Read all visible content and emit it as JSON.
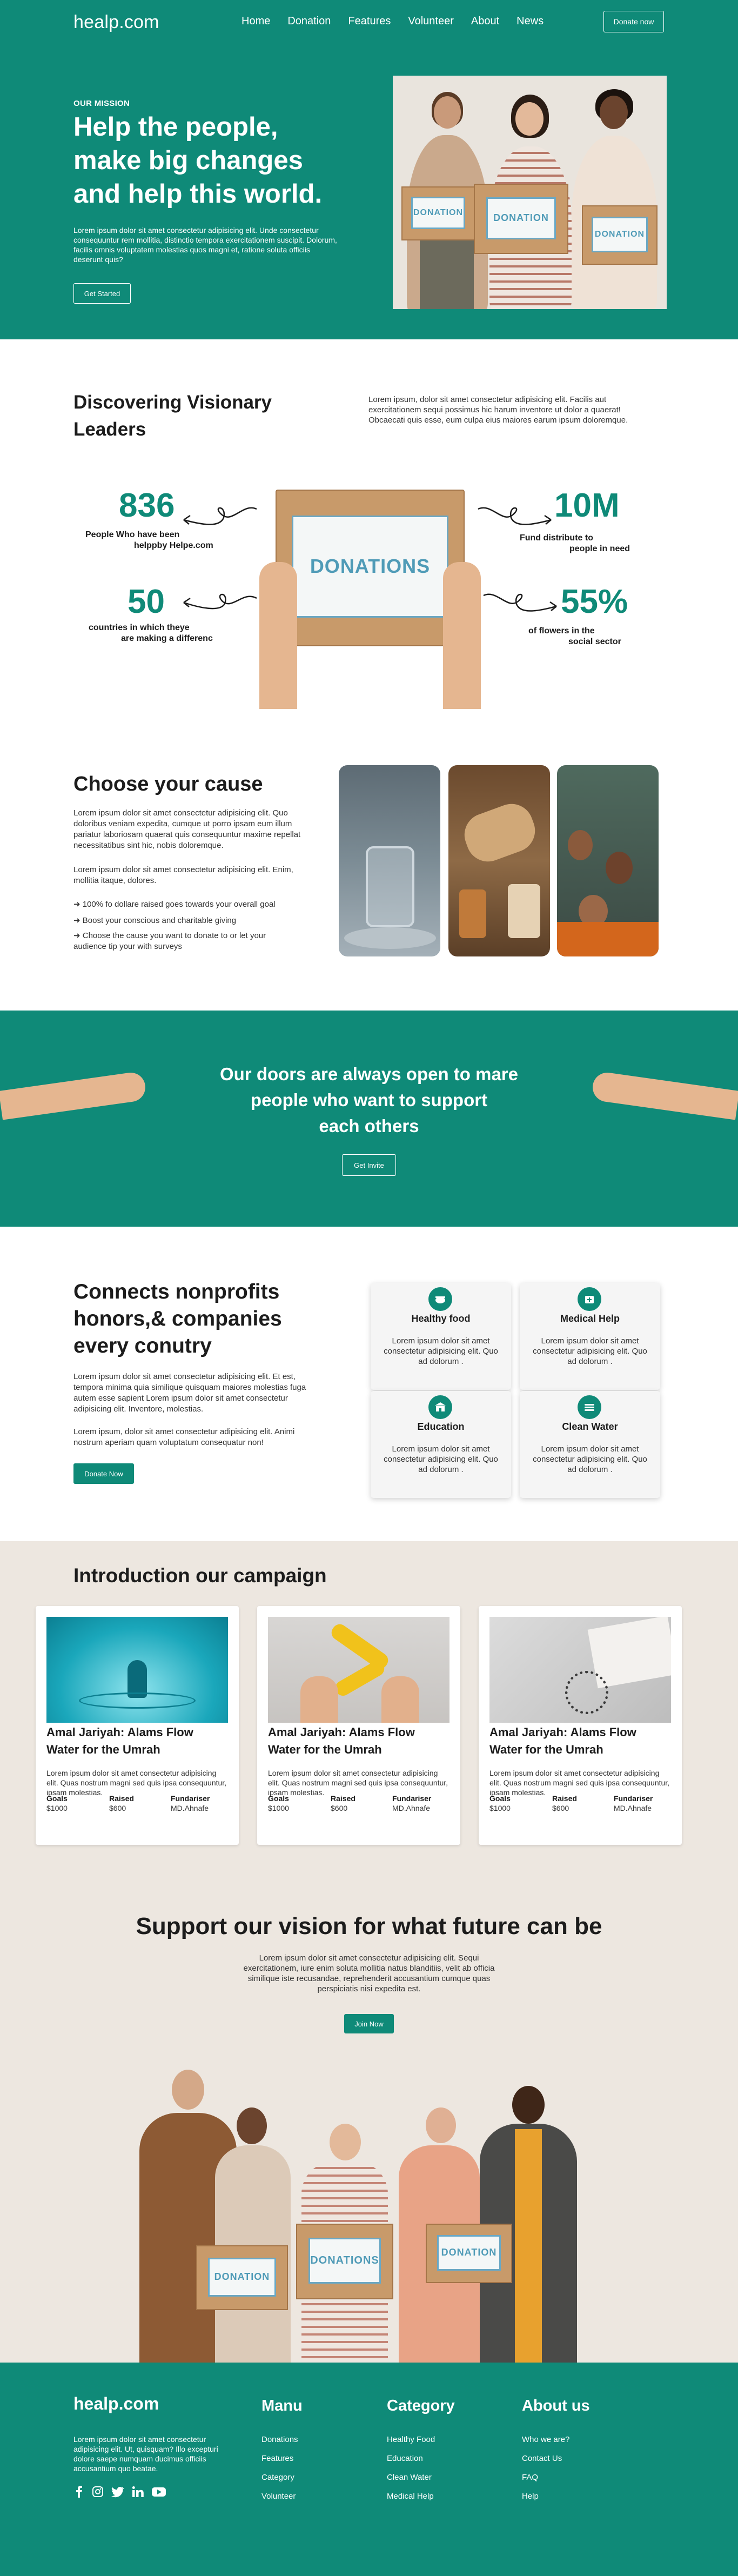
{
  "nav": {
    "logo": "healp.com",
    "menu": [
      "Home",
      "Donation",
      "Features",
      "Volunteer",
      "About",
      "News"
    ],
    "cta": "Donate now"
  },
  "hero": {
    "kicker": "OUR MISSION",
    "title_lines": [
      "Help the people,",
      "make big changes",
      "and help this world."
    ],
    "text": "Lorem ipsum dolor sit amet consectetur adipisicing elit. Unde consectetur consequuntur rem mollitia, distinctio tempora exercitationem suscipit. Dolorum, facilis omnis voluptatem molestias quos magni et, ratione soluta officiis deserunt quis?",
    "button": "Get Started",
    "box_label": "DONATION"
  },
  "leaders": {
    "title_lines": [
      "Discovering Visionary",
      "Leaders"
    ],
    "text": "Lorem ipsum, dolor sit amet consectetur adipisicing elit. Facilis aut exercitationem sequi possimus hic harum inventore ut dolor a quaerat! Obcaecati quis esse, eum culpa eius maiores earum ipsum doloremque.",
    "box_label": "DONATIONS",
    "stats": [
      {
        "value": "836",
        "label_lines": [
          "People Who have been",
          "helppby Helpe.com"
        ]
      },
      {
        "value": "10M",
        "label_lines": [
          "Fund distribute to",
          "people in need"
        ]
      },
      {
        "value": "50",
        "label_lines": [
          "countries in which theye",
          "are making a differenc"
        ]
      },
      {
        "value": "55%",
        "label_lines": [
          "of flowers in the",
          "social sector"
        ]
      }
    ]
  },
  "cause": {
    "title": "Choose your cause",
    "p1": "Lorem ipsum dolor sit amet consectetur adipisicing elit. Quo doloribus veniam expedita, cumque ut porro ipsam eum illum pariatur laboriosam quaerat quis consequuntur maxime repellat necessitatibus sint hic, nobis doloremque.",
    "p2": "Lorem ipsum dolor sit amet consectetur adipisicing elit. Enim, mollitia itaque, dolores.",
    "checks": [
      "100% fo dollare raised goes towards your overall goal",
      "Boost your conscious and charitable giving",
      "Choose the cause you want to donate to or let your audience tip your with surveys"
    ],
    "arrow": "➜"
  },
  "banner": {
    "title_lines": [
      "Our doors are always open to mare",
      "people who want to support",
      "each others"
    ],
    "button": "Get Invite"
  },
  "connects": {
    "title_lines": [
      "Connects nonprofits",
      "honors,& companies",
      "every conutry"
    ],
    "p1": "Lorem ipsum dolor sit amet consectetur adipisicing elit. Et est, tempora minima quia similique quisquam maiores molestias fuga autem esse sapient Lorem ipsum dolor sit amet consectetur adipisicing elit. Inventore, molestias.",
    "p2": "Lorem ipsum, dolor sit amet consectetur adipisicing elit. Animi nostrum aperiam quam voluptatum consequatur non!",
    "button": "Donate Now",
    "cards": [
      {
        "title": "Healthy food",
        "icon": "food-icon",
        "text": "Lorem ipsum dolor sit amet consectetur adipisicing elit. Quo ad dolorum ."
      },
      {
        "title": "Medical Help",
        "icon": "medical-icon",
        "text": "Lorem ipsum dolor sit amet consectetur adipisicing elit. Quo ad dolorum ."
      },
      {
        "title": "Education",
        "icon": "school-icon",
        "text": "Lorem ipsum dolor sit amet consectetur adipisicing elit. Quo ad dolorum ."
      },
      {
        "title": "Clean Water",
        "icon": "water-icon",
        "text": "Lorem ipsum dolor sit amet consectetur adipisicing elit. Quo ad dolorum ."
      }
    ]
  },
  "campaign": {
    "title": "Introduction our campaign",
    "cards": [
      {
        "title_lines": [
          "Amal Jariyah: Alams Flow",
          "Water for the Umrah"
        ],
        "text": "Lorem ipsum dolor sit amet consectetur adipisicing elit. Quas nostrum magni sed quis ipsa consequuntur, ipsam molestias.",
        "goals_label": "Goals",
        "goals": "$1000",
        "raised_label": "Raised",
        "raised": "$600",
        "fund_label": "Fundariser",
        "fund": "MD.Ahnafe"
      },
      {
        "title_lines": [
          "Amal Jariyah: Alams Flow",
          "Water for the Umrah"
        ],
        "text": "Lorem ipsum dolor sit amet consectetur adipisicing elit. Quas nostrum magni sed quis ipsa consequuntur, ipsam molestias.",
        "goals_label": "Goals",
        "goals": "$1000",
        "raised_label": "Raised",
        "raised": "$600",
        "fund_label": "Fundariser",
        "fund": "MD.Ahnafe"
      },
      {
        "title_lines": [
          "Amal Jariyah: Alams Flow",
          "Water for the Umrah"
        ],
        "text": "Lorem ipsum dolor sit amet consectetur adipisicing elit. Quas nostrum magni sed quis ipsa consequuntur, ipsam molestias.",
        "goals_label": "Goals",
        "goals": "$1000",
        "raised_label": "Raised",
        "raised": "$600",
        "fund_label": "Fundariser",
        "fund": "MD.Ahnafe"
      }
    ]
  },
  "vision": {
    "title": "Support our vision for what future can be",
    "text": "Lorem ipsum dolor sit amet consectetur adipisicing elit. Sequi exercitationem, iure enim soluta mollitia natus blanditiis, velit ab officia similique iste recusandae, reprehenderit accusantium cumque quas perspiciatis nisi expedita est.",
    "button": "Join Now",
    "box_label_1": "DONATION",
    "box_label_2": "DONATIONS"
  },
  "footer": {
    "logo": "healp.com",
    "text": "Lorem ipsum dolor sit amet consectetur adipisicing elit. Ut, quisquam? Illo excepturi dolore saepe numquam ducimus officiis accusantium quo beatae.",
    "col1": {
      "title": "Manu",
      "links": [
        "Donations",
        "Features",
        "Category",
        "Volunteer"
      ]
    },
    "col2": {
      "title": "Category",
      "links": [
        "Healthy Food",
        "Education",
        "Clean Water",
        "Medical Help"
      ]
    },
    "col3": {
      "title": "About us",
      "links": [
        "Who we are?",
        "Contact Us",
        "FAQ",
        "Help"
      ]
    },
    "social": [
      "facebook-icon",
      "instagram-icon",
      "twitter-icon",
      "linkedin-icon",
      "youtube-icon"
    ]
  },
  "colors": {
    "primary": "#0f8a78",
    "beige": "#ede7e0",
    "box": "#c89a6a"
  }
}
